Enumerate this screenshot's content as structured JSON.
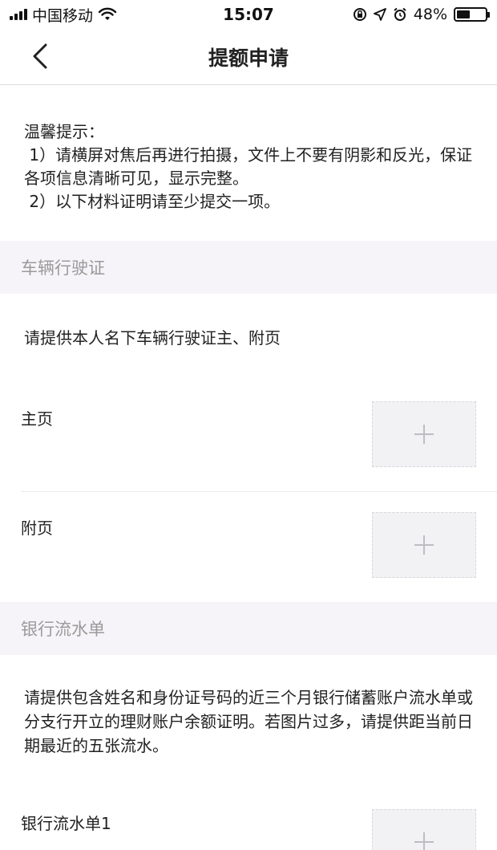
{
  "status_bar": {
    "carrier": "中国移动",
    "time": "15:07",
    "battery_percent": "48%",
    "battery_level": 0.48,
    "icons": [
      "signal-icon",
      "wifi-icon",
      "rotation-lock-icon",
      "location-icon",
      "alarm-icon",
      "battery-icon"
    ]
  },
  "nav": {
    "title": "提额申请",
    "back_icon": "chevron-left-icon"
  },
  "tips": {
    "heading": "温馨提示：",
    "line1": " 1）请横屏对焦后再进行拍摄，文件上不要有阴影和反光，保证各项信息清晰可见，显示完整。",
    "line2": " 2）以下材料证明请至少提交一项。"
  },
  "sections": {
    "vehicle": {
      "header": "车辆行驶证",
      "description": "请提供本人名下车辆行驶证主、附页",
      "items": [
        {
          "label": "主页"
        },
        {
          "label": "附页"
        }
      ]
    },
    "bank": {
      "header": "银行流水单",
      "description": "请提供包含姓名和身份证号码的近三个月银行储蓄账户流水单或分支行开立的理财账户余额证明。若图片过多，请提供距当前日期最近的五张流水。",
      "items": [
        {
          "label": "银行流水单1"
        }
      ]
    }
  },
  "colors": {
    "section_bg": "#f6f4f8",
    "section_text": "#9a9a9a",
    "upload_bg": "#f2f2f4",
    "plus": "#bdbdc2"
  }
}
